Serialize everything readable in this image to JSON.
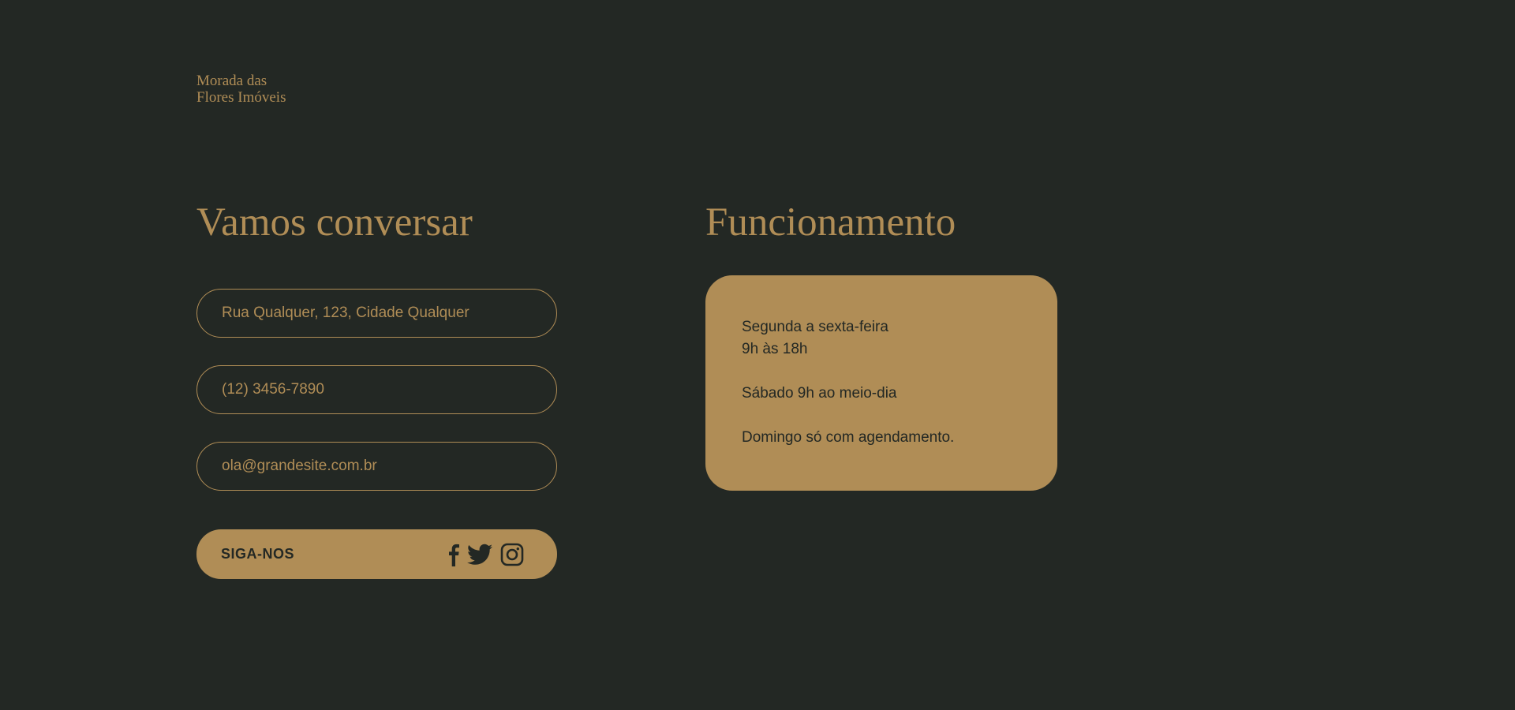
{
  "brand": {
    "line1": "Morada das",
    "line2": "Flores Imóveis"
  },
  "contact": {
    "heading": "Vamos conversar",
    "address": "Rua Qualquer, 123, Cidade Qualquer",
    "phone": "(12) 3456-7890",
    "email": "ola@grandesite.com.br"
  },
  "social": {
    "label": "SIGA-NOS",
    "icons": [
      "facebook-icon",
      "twitter-icon",
      "instagram-icon"
    ]
  },
  "hours": {
    "heading": "Funcionamento",
    "weekdays_line1": "Segunda a sexta-feira",
    "weekdays_line2": "9h às 18h",
    "saturday": "Sábado 9h ao meio-dia",
    "sunday": "Domingo só com agendamento."
  },
  "colors": {
    "background": "#232824",
    "accent": "#b08d56"
  }
}
